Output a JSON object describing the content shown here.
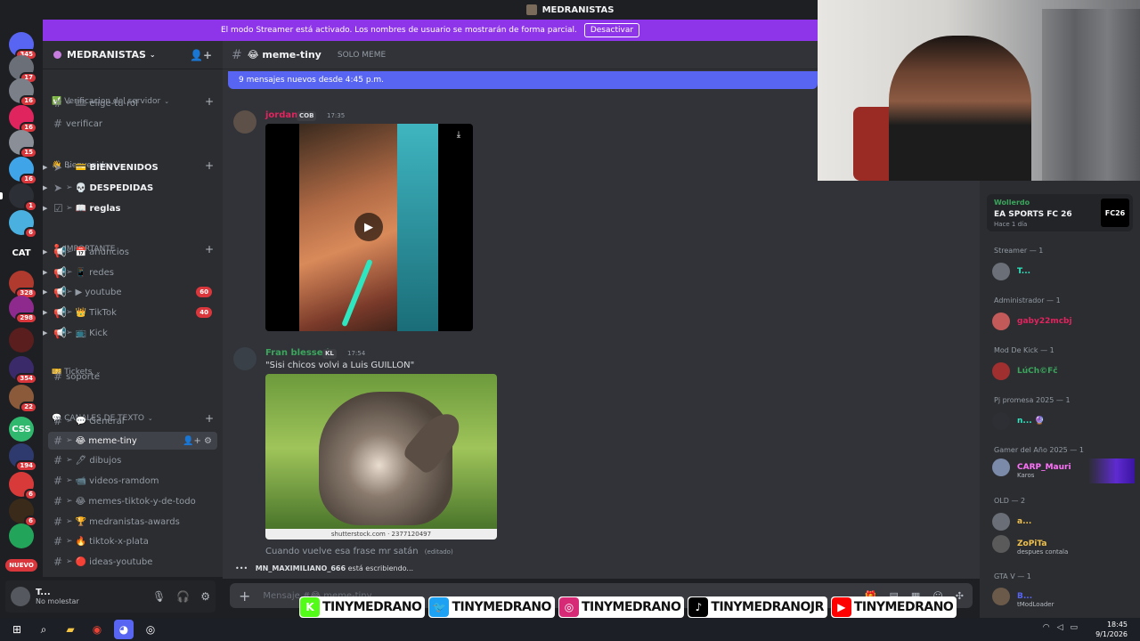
{
  "window_title": "MEDRANISTAS",
  "streamer_banner": {
    "text": "El modo Streamer está activado. Los nombres de usuario se mostrarán de forma parcial.",
    "button": "Desactivar"
  },
  "servers": [
    {
      "label": "",
      "badge": "345",
      "color": "#5865f2"
    },
    {
      "label": "",
      "badge": "17",
      "color": "#6b6f78"
    },
    {
      "label": "",
      "badge": "16",
      "color": "#7a7f88"
    },
    {
      "label": "",
      "badge": "16",
      "color": "#e0245e"
    },
    {
      "label": "",
      "badge": "15",
      "color": "#8a8e96"
    },
    {
      "label": "",
      "badge": "16",
      "color": "#3fa4e8"
    },
    {
      "label": "",
      "badge": "1",
      "color": "#2c2f36"
    },
    {
      "label": "",
      "badge": "6",
      "color": "#4ab0e0"
    },
    {
      "label": "CAT",
      "badge": "",
      "color": "#1e1f22"
    },
    {
      "label": "",
      "badge": "328",
      "color": "#b03a2e"
    },
    {
      "label": "",
      "badge": "298",
      "color": "#8e2a8e"
    },
    {
      "label": "",
      "badge": "",
      "color": "#5a1e1e"
    },
    {
      "label": "",
      "badge": "354",
      "color": "#3a2a6a"
    },
    {
      "label": "",
      "badge": "22",
      "color": "#8a5a3a"
    },
    {
      "label": "CSS",
      "badge": "",
      "color": "#2fb86e"
    },
    {
      "label": "",
      "badge": "194",
      "color": "#2e3a6e"
    },
    {
      "label": "",
      "badge": "6",
      "color": "#d83a3a"
    },
    {
      "label": "",
      "badge": "6",
      "color": "#3a2a1a"
    },
    {
      "label": "",
      "badge": "",
      "color": "#22a55a"
    }
  ],
  "nuevo": "NUEVO",
  "guild": {
    "name": "MEDRANISTAS"
  },
  "categories": [
    {
      "name": "✅ Verificacion del servidor",
      "add": "+"
    },
    {
      "name": "👋 Bienvenidos",
      "add": "+"
    },
    {
      "name": "📍 IMPORTANTE",
      "add": "+"
    },
    {
      "name": "🎫 Tickets",
      "add": ""
    },
    {
      "name": "💬 CANALES DE TEXTO",
      "add": "+"
    }
  ],
  "channels": [
    {
      "name": "🎟 elige-tu-rol",
      "badge": ""
    },
    {
      "name": "verificar",
      "badge": ""
    },
    {
      "name": "💳 BIENVENIDOS",
      "badge": ""
    },
    {
      "name": "💀 DESPEDIDAS",
      "badge": ""
    },
    {
      "name": "📖 reglas",
      "badge": ""
    },
    {
      "name": "📅 anuncios",
      "badge": ""
    },
    {
      "name": "📱 redes",
      "badge": ""
    },
    {
      "name": "▶ youtube",
      "badge": "60"
    },
    {
      "name": "👑 TikTok",
      "badge": "40"
    },
    {
      "name": "📺 Kick",
      "badge": ""
    },
    {
      "name": "soporte",
      "badge": ""
    },
    {
      "name": "💬 General",
      "badge": ""
    },
    {
      "name": "😂 meme-tiny",
      "badge": ""
    },
    {
      "name": "🖊 dibujos",
      "badge": ""
    },
    {
      "name": "📹 videos-ramdom",
      "badge": ""
    },
    {
      "name": "😂 memes-tiktok-y-de-todo",
      "badge": ""
    },
    {
      "name": "🏆 medranistas-awards",
      "badge": ""
    },
    {
      "name": "🔥 tiktok-x-plata",
      "badge": ""
    },
    {
      "name": "🔴 ideas-youtube",
      "badge": ""
    }
  ],
  "user_panel": {
    "name": "T...",
    "status": "No molestar"
  },
  "header": {
    "channel": "😂 meme-tiny",
    "topic": "SOLO MEME"
  },
  "new_messages": "9 mensajes nuevos desde 4:45 p.m.",
  "messages": [
    {
      "author": "jordan",
      "tag": "COB",
      "time": "17:35",
      "color": "#e0245e",
      "text": ""
    },
    {
      "author": "Fran blessed",
      "tag": "KL",
      "time": "17:54",
      "color": "#3ba55c",
      "text": "\"Sisi chicos volvi a Luis GUILLON\""
    }
  ],
  "image_caption": "shutterstock.com · 2377120497",
  "last_message": "Cuando vuelve esa frase mr satán",
  "edited": "(editado)",
  "typing": {
    "dots": "•••",
    "user": "MN_MAXIMILIANO_666",
    "text": "está escribiendo..."
  },
  "input_placeholder": "Mensaje #😂 meme-tiny",
  "activity": {
    "user": "Wollerdo",
    "game": "EA SPORTS FC 26",
    "ago": "Hace 1 día",
    "logo": "FC26"
  },
  "member_groups": [
    {
      "title": "Streamer — 1",
      "members": [
        {
          "name": "T...",
          "color": "#2ee6c0",
          "sub": ""
        }
      ]
    },
    {
      "title": "Administrador — 1",
      "members": [
        {
          "name": "gaby22mcbj",
          "color": "#e0245e",
          "sub": ""
        }
      ]
    },
    {
      "title": "Mod De Kick — 1",
      "members": [
        {
          "name": "LúCh©Fč",
          "color": "#3ba55c",
          "sub": ""
        }
      ]
    },
    {
      "title": "Pj promesa 2025 — 1",
      "members": [
        {
          "name": "n... 🔮",
          "color": "#2ee6c0",
          "sub": ""
        }
      ]
    },
    {
      "title": "Gamer del Año 2025 — 1",
      "members": [
        {
          "name": "CARP_Mauri",
          "color": "#ff73fa",
          "sub": "Karos"
        }
      ]
    },
    {
      "title": "OLD — 2",
      "members": [
        {
          "name": "a...",
          "color": "#f0c14b",
          "sub": ""
        },
        {
          "name": "ZoPiTa",
          "color": "#f0c14b",
          "sub": "despues contala"
        }
      ]
    },
    {
      "title": "GTA V — 1",
      "members": [
        {
          "name": "B...",
          "color": "#5865f2",
          "sub": "tModLoader"
        }
      ]
    }
  ],
  "social": [
    {
      "icon": "K",
      "color": "#53fc18",
      "handle": "TINYMEDRANO"
    },
    {
      "icon": "🐦",
      "color": "#1da1f2",
      "handle": "TINYMEDRANO"
    },
    {
      "icon": "◎",
      "color": "#d62976",
      "handle": "TINYMEDRANO"
    },
    {
      "icon": "♪",
      "color": "#000000",
      "handle": "TINYMEDRANOJR"
    },
    {
      "icon": "▶",
      "color": "#ff0000",
      "handle": "TINYMEDRANO"
    }
  ],
  "clock": {
    "time": "18:45",
    "date": "9/1/2026"
  }
}
